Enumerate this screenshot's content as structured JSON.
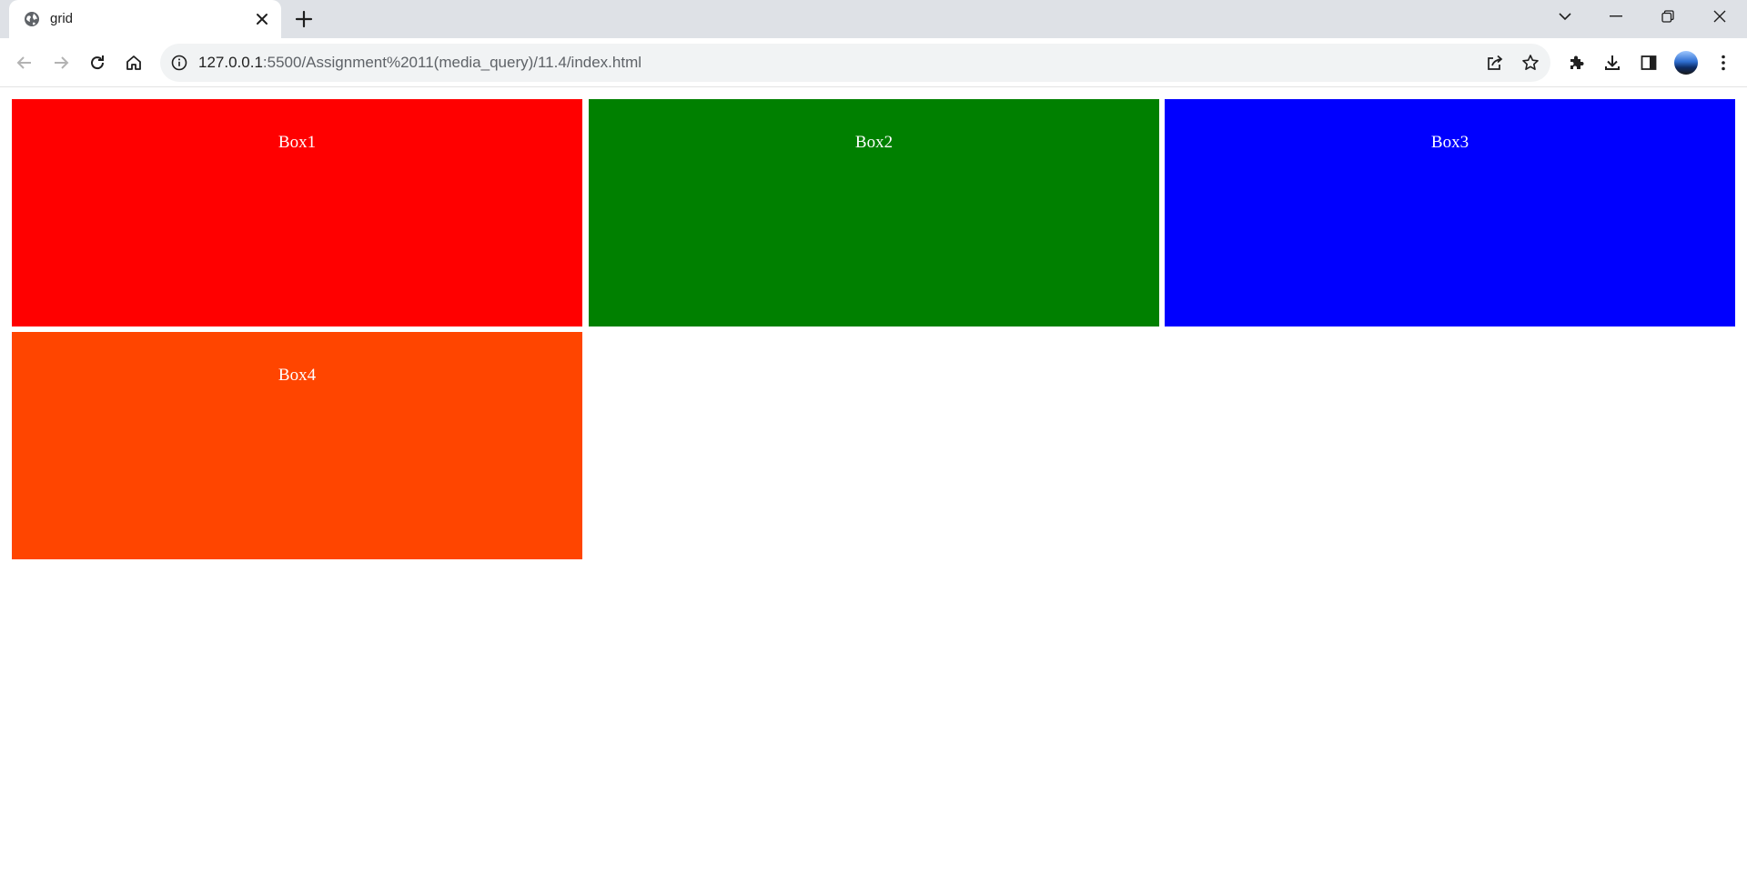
{
  "browser": {
    "tab": {
      "title": "grid",
      "favicon": "globe-icon"
    },
    "address_bar": {
      "url_host": "127.0.0.1",
      "url_rest": ":5500/Assignment%2011(media_query)/11.4/index.html"
    },
    "icons": {
      "back": "arrow-left-icon",
      "forward": "arrow-right-icon",
      "reload": "reload-icon",
      "home": "home-icon",
      "share": "share-icon",
      "bookmark": "star-icon",
      "extensions": "puzzle-icon",
      "downloads": "download-icon",
      "side_panel": "side-panel-icon",
      "menu": "kebab-menu-icon"
    }
  },
  "page": {
    "boxes": [
      {
        "label": "Box1",
        "color": "#ff0000"
      },
      {
        "label": "Box2",
        "color": "#008000"
      },
      {
        "label": "Box3",
        "color": "#0000ff"
      },
      {
        "label": "Box4",
        "color": "#ff4500"
      }
    ]
  }
}
